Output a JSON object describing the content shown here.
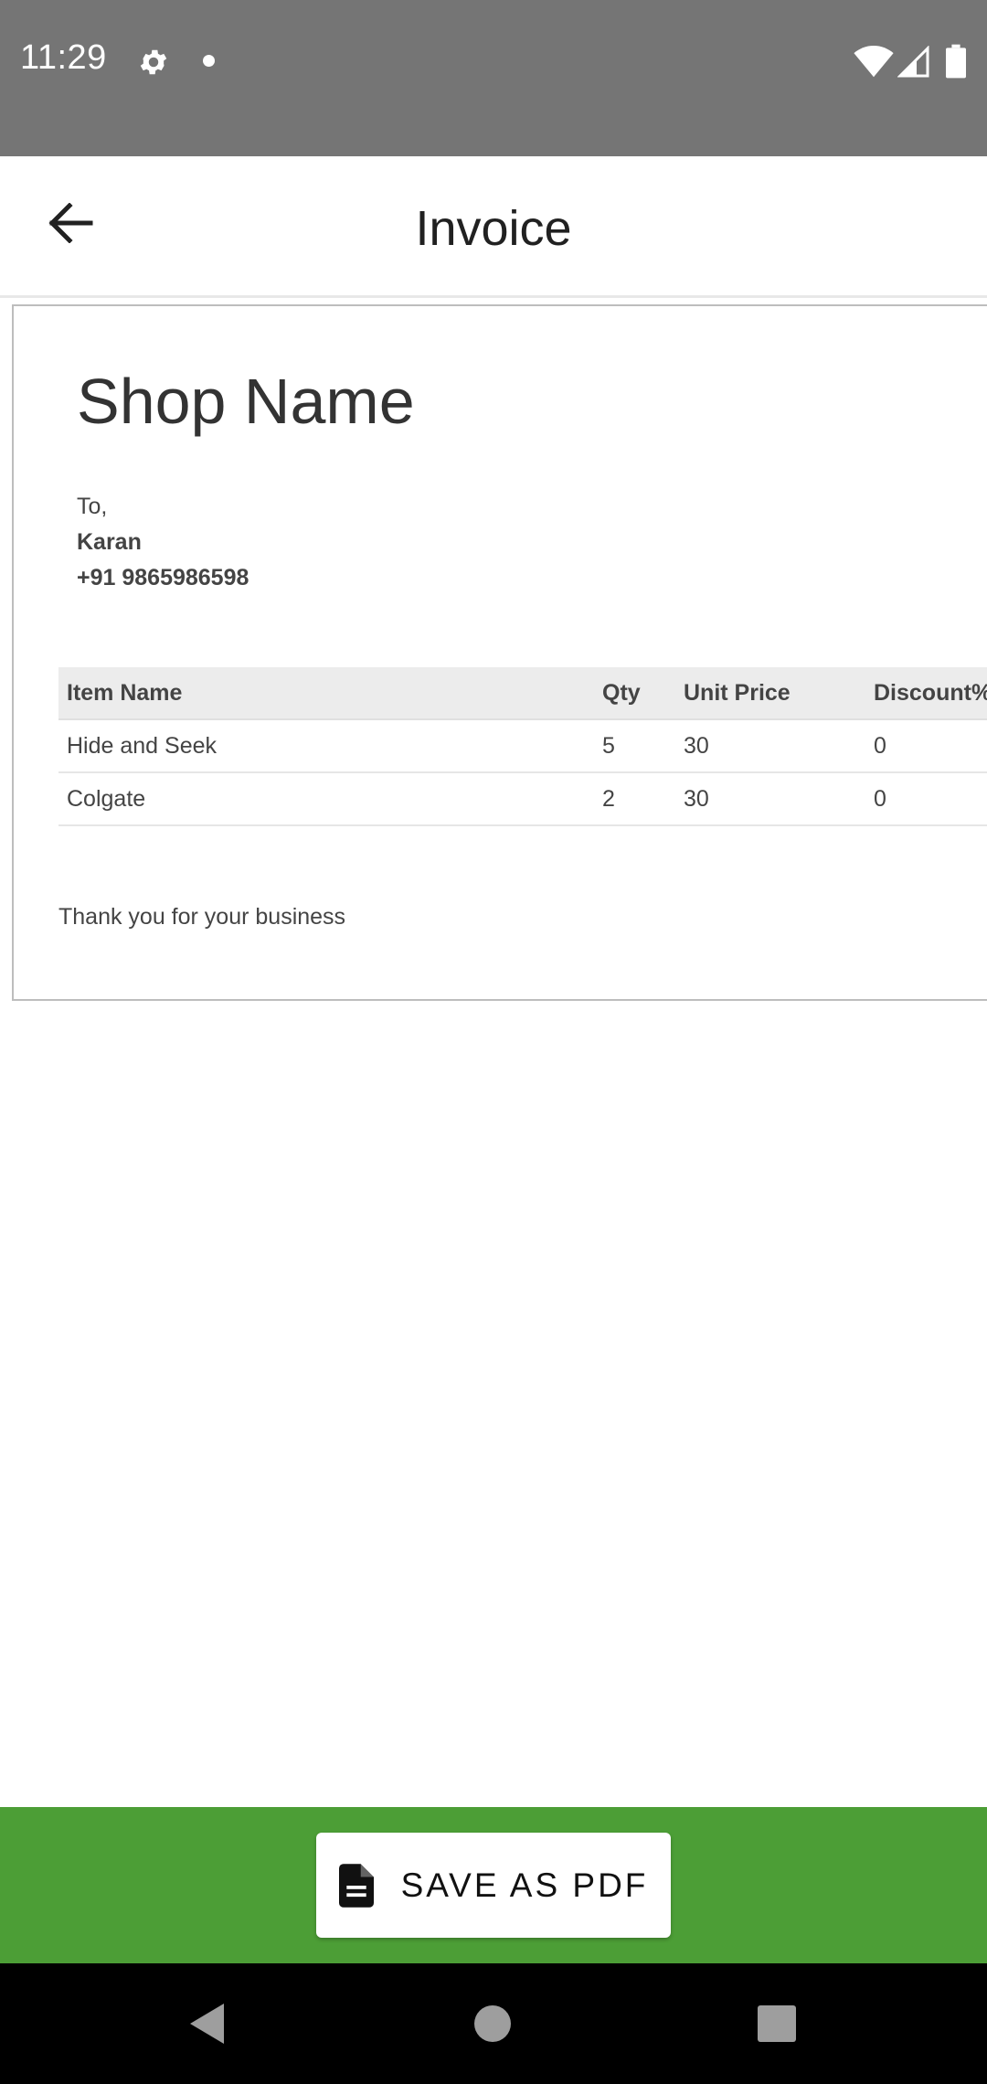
{
  "status_bar": {
    "time": "11:29",
    "background": "#757575"
  },
  "app_bar": {
    "title": "Invoice"
  },
  "invoice": {
    "shop_name": "Shop Name",
    "to_label": "To,",
    "customer_name": "Karan",
    "customer_phone": "+91 9865986598",
    "table": {
      "headers": [
        "Item Name",
        "Qty",
        "Unit Price",
        "Discount%"
      ],
      "rows": [
        [
          "Hide and Seek",
          "5",
          "30",
          "0"
        ],
        [
          "Colgate",
          "2",
          "30",
          "0"
        ]
      ]
    },
    "footer_note": "Thank you for your business"
  },
  "action": {
    "save_pdf_label": "SAVE AS PDF",
    "icon": "document-icon",
    "bar_color": "#4c9e36"
  },
  "navigation": {
    "icons": [
      "nav-back-icon",
      "nav-home-icon",
      "nav-recents-icon"
    ]
  }
}
